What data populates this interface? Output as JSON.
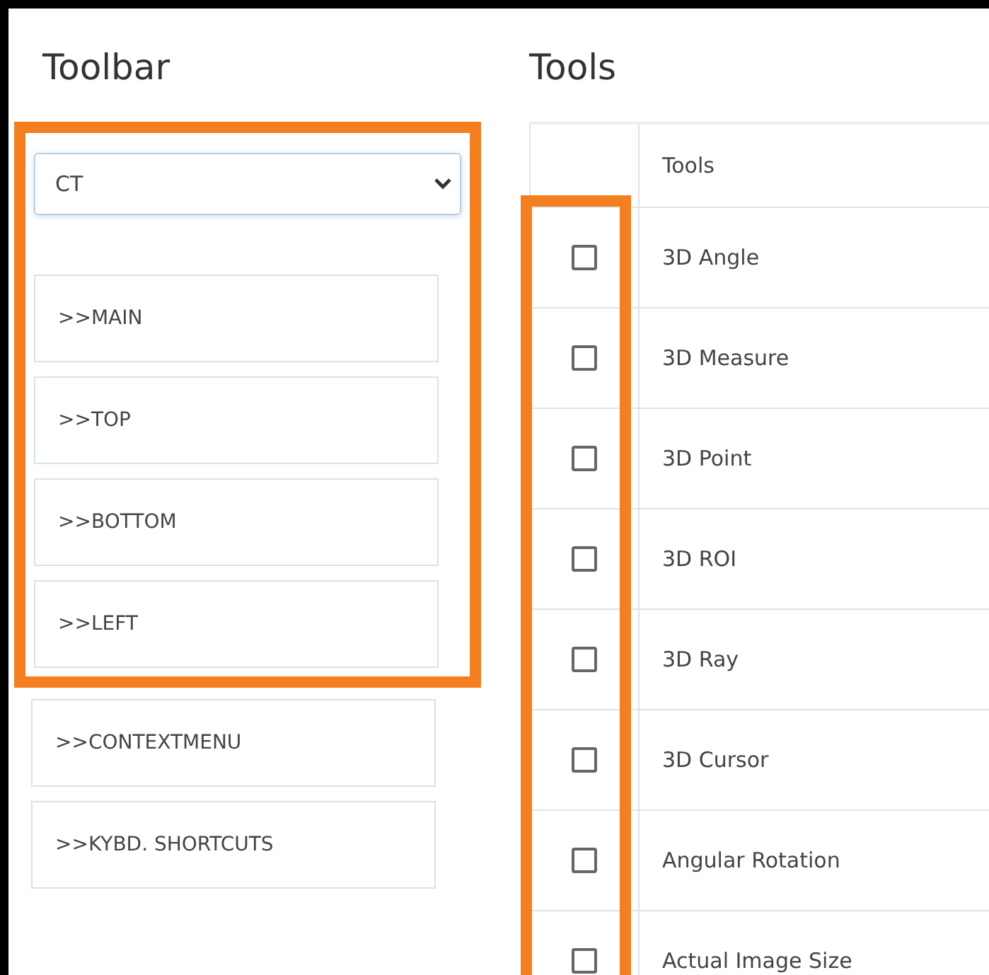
{
  "toolbar": {
    "title": "Toolbar",
    "highlighted": true,
    "select": {
      "value": "CT"
    },
    "framed_buttons": [
      ">>MAIN",
      ">>TOP",
      ">>BOTTOM",
      ">>LEFT"
    ],
    "buttons": [
      ">>CONTEXTMENU",
      ">>KYBD. SHORTCUTS"
    ]
  },
  "tools": {
    "title": "Tools",
    "checkbox_column_highlighted": true,
    "table": {
      "columns": [
        "Tools"
      ],
      "rows": [
        {
          "name": "3D Angle",
          "checked": false
        },
        {
          "name": "3D Measure",
          "checked": false
        },
        {
          "name": "3D Point",
          "checked": false
        },
        {
          "name": "3D ROI",
          "checked": false
        },
        {
          "name": "3D Ray",
          "checked": false
        },
        {
          "name": "3D Cursor",
          "checked": false
        },
        {
          "name": "Angular Rotation",
          "checked": false
        },
        {
          "name": "Actual Image Size",
          "checked": false
        }
      ]
    }
  }
}
